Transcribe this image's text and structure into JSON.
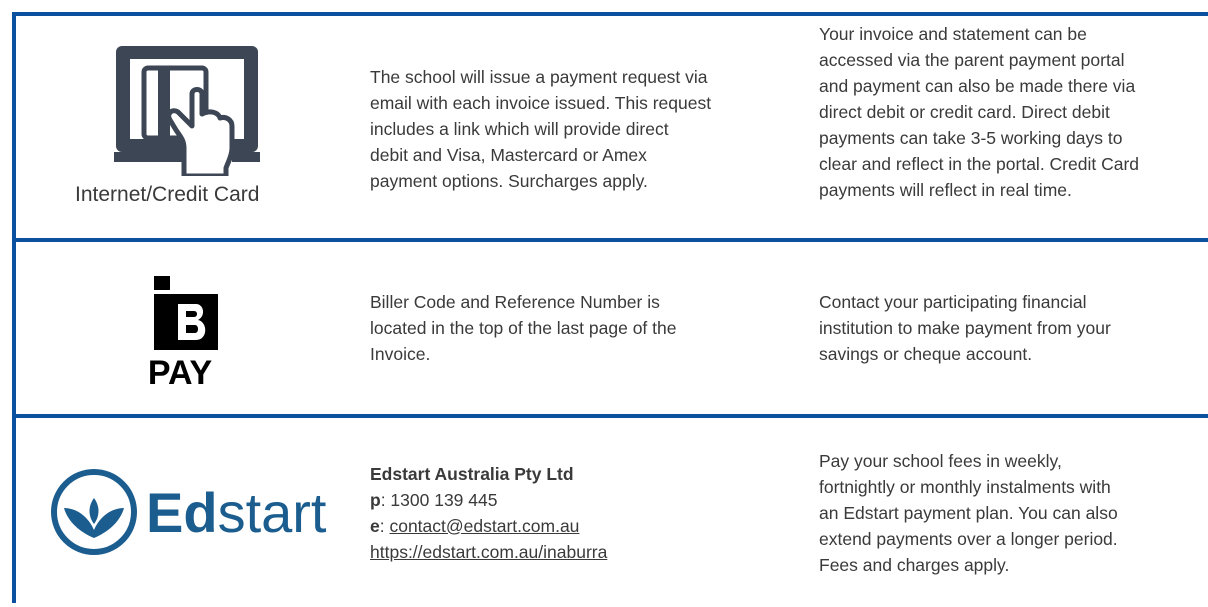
{
  "rows": [
    {
      "icon": "credit-card-hand-icon",
      "icon_label": "Internet/Credit Card",
      "middle_lines": [
        "The school will issue a payment request via",
        "email with each invoice issued. This request",
        "includes a link which will provide direct",
        "debit and Visa, Mastercard or Amex",
        "payment options. Surcharges apply."
      ],
      "right_lines": [
        "Your invoice and statement can be",
        "accessed via the parent payment portal",
        "and payment can also be made there via",
        "direct debit or credit card. Direct debit",
        "payments can take 3-5 working days to",
        "clear and reflect in the portal. Credit Card",
        "payments will reflect in real time."
      ]
    },
    {
      "icon": "bpay-logo-icon",
      "logo_text": "PAY",
      "middle_lines": [
        "Biller Code and Reference Number is",
        "located in the top of the last page of the",
        "Invoice."
      ],
      "right_lines": [
        "Contact your participating financial",
        "institution to make payment from your",
        "savings or cheque account."
      ]
    },
    {
      "icon": "edstart-logo-icon",
      "logo_text_bold": "Ed",
      "logo_text_light": "start",
      "company": "Edstart Australia Pty Ltd",
      "phone_label": "p",
      "phone_value": ": 1300 139 445",
      "email_label": "e",
      "email_sep": ": ",
      "email_value": "contact@edstart.com.au",
      "url": "https://edstart.com.au/inaburra",
      "right_lines": [
        "Pay your school fees in weekly,",
        "fortnightly or monthly instalments with",
        "an Edstart payment plan. You can also",
        "extend payments over a longer period.",
        "Fees and charges apply."
      ]
    }
  ],
  "colors": {
    "border": "#0b51a0",
    "icon_dark": "#3d4654",
    "edstart_blue": "#1c5d8f",
    "text": "#3a3a3a"
  }
}
